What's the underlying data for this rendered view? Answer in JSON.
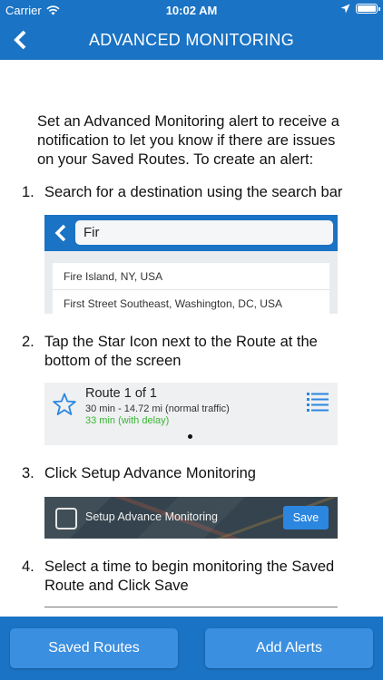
{
  "status_bar": {
    "carrier": "Carrier",
    "time": "10:02 AM"
  },
  "nav": {
    "title": "ADVANCED MONITORING",
    "back_icon": "chevron-left-icon"
  },
  "content": {
    "intro": "Set an Advanced Monitoring alert to receive a notification to let you know if there are issues on your Saved Routes. To create an alert:",
    "steps": [
      {
        "num": "1.",
        "text": "Search for a destination using the search bar"
      },
      {
        "num": "2.",
        "text": "Tap the Star Icon next to the Route at the bottom of the screen"
      },
      {
        "num": "3.",
        "text": "Click Setup Advance Monitoring"
      },
      {
        "num": "4.",
        "text": "Select a time to begin monitoring the Saved Route and Click Save"
      }
    ],
    "search_example": {
      "query": "Fir",
      "results": [
        "Fire Island, NY, USA",
        "First Street Southeast, Washington, DC, USA"
      ]
    },
    "route_example": {
      "title": "Route 1 of 1",
      "subtitle": "30 min - 14.72 mi (normal traffic)",
      "delay": "33 min (with delay)"
    },
    "monitor_example": {
      "label": "Setup Advance Monitoring",
      "save": "Save"
    }
  },
  "bottom": {
    "saved_routes": "Saved Routes",
    "add_alerts": "Add Alerts"
  },
  "colors": {
    "brand_blue": "#1a73c4",
    "button_blue": "#3a8fe0",
    "delay_green": "#3ab534"
  }
}
